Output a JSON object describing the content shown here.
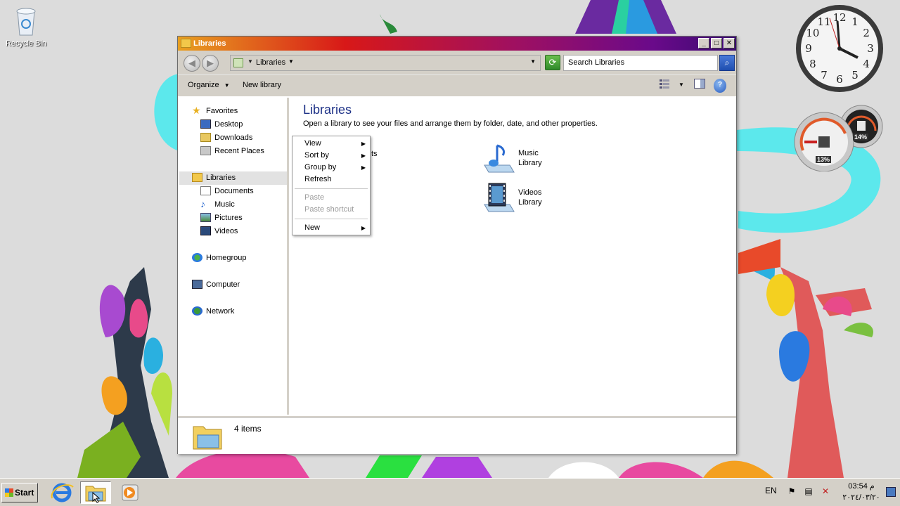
{
  "desktop": {
    "recycle_bin_label": "Recycle Bin"
  },
  "gadgets": {
    "clock_numbers": [
      "12",
      "1",
      "2",
      "3",
      "4",
      "5",
      "6",
      "7",
      "8",
      "9",
      "10",
      "11"
    ],
    "cpu_percent_label": "13%",
    "memory_percent_label": "14%"
  },
  "window": {
    "title": "Libraries",
    "min_glyph": "_",
    "max_glyph": "□",
    "close_glyph": "✕",
    "address": {
      "crumb": "Libraries",
      "back_glyph": "◀",
      "forward_glyph": "▶"
    },
    "search": {
      "placeholder": "Search Libraries"
    },
    "toolbar": {
      "organize_label": "Organize",
      "new_library_label": "New library",
      "help_glyph": "?"
    },
    "nav": {
      "favorites": "Favorites",
      "desktop": "Desktop",
      "downloads": "Downloads",
      "recent_places": "Recent Places",
      "libraries": "Libraries",
      "documents": "Documents",
      "music": "Music",
      "pictures": "Pictures",
      "videos": "Videos",
      "homegroup": "Homegroup",
      "computer": "Computer",
      "network": "Network"
    },
    "main": {
      "title": "Libraries",
      "subtitle": "Open a library to see your files and arrange them by folder, date, and other properties.",
      "partial_item_text": "ts",
      "items": [
        {
          "name": "Music",
          "sub": "Library"
        },
        {
          "name": "Videos",
          "sub": "Library"
        }
      ]
    },
    "details": {
      "count_text": "4 items"
    }
  },
  "context_menu": {
    "items": [
      {
        "label": "View",
        "submenu": true,
        "disabled": false
      },
      {
        "label": "Sort by",
        "submenu": true,
        "disabled": false
      },
      {
        "label": "Group by",
        "submenu": true,
        "disabled": false
      },
      {
        "label": "Refresh",
        "submenu": false,
        "disabled": false
      },
      {
        "label": "Paste",
        "submenu": false,
        "disabled": true
      },
      {
        "label": "Paste shortcut",
        "submenu": false,
        "disabled": true
      },
      {
        "label": "New",
        "submenu": true,
        "disabled": false
      }
    ],
    "arrow_glyph": "▶"
  },
  "taskbar": {
    "start_label": "Start",
    "language": "EN",
    "time": "03:54 م",
    "date": "٢٠٢٤/٠٣/٢٠"
  },
  "colors": {
    "title_accent": "#1e3287",
    "selection": "#e2e2e2"
  }
}
